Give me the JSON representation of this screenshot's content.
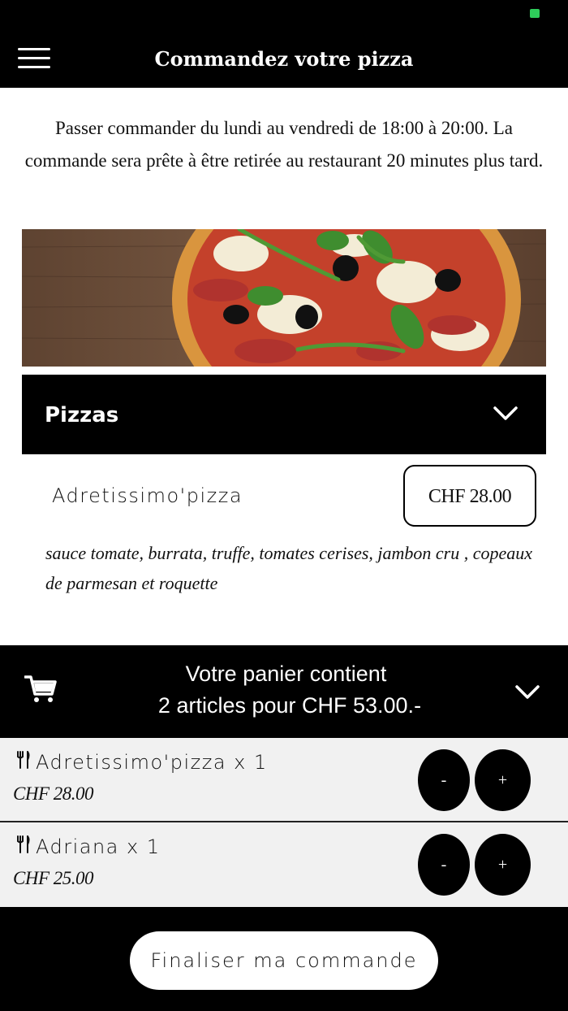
{
  "header": {
    "title": "Commandez votre pizza",
    "menu_icon": "hamburger-icon"
  },
  "status": {
    "indicator_color": "#2ecc5a"
  },
  "intro": {
    "text": "Passer commander du lundi au vendredi de 18:00 à 20:00. La commande sera prête à être retirée au restaurant 20 minutes plus tard."
  },
  "hero": {
    "image": "pizza-photo"
  },
  "category": {
    "title": "Pizzas",
    "icon": "chevron-down-icon"
  },
  "product": {
    "name": "Adretissimo'pizza",
    "price": "CHF 28.00",
    "description": "sauce tomate, burrata, truffe, tomates cerises, jambon cru , copeaux de parmesan et roquette"
  },
  "cart": {
    "line1": "Votre panier contient",
    "line2": "2 articles pour CHF 53.00.-",
    "icon": "shopping-cart-icon",
    "items": [
      {
        "name": "Adretissimo'pizza x 1",
        "price": "CHF 28.00",
        "minus": "-",
        "plus": "+"
      },
      {
        "name": "Adriana x 1",
        "price": "CHF 25.00",
        "minus": "-",
        "plus": "+"
      }
    ]
  },
  "footer": {
    "finalize_label": "Finaliser ma commande"
  },
  "colors": {
    "primary": "#000000",
    "background": "#ffffff",
    "row_bg": "#f1f1f1"
  }
}
